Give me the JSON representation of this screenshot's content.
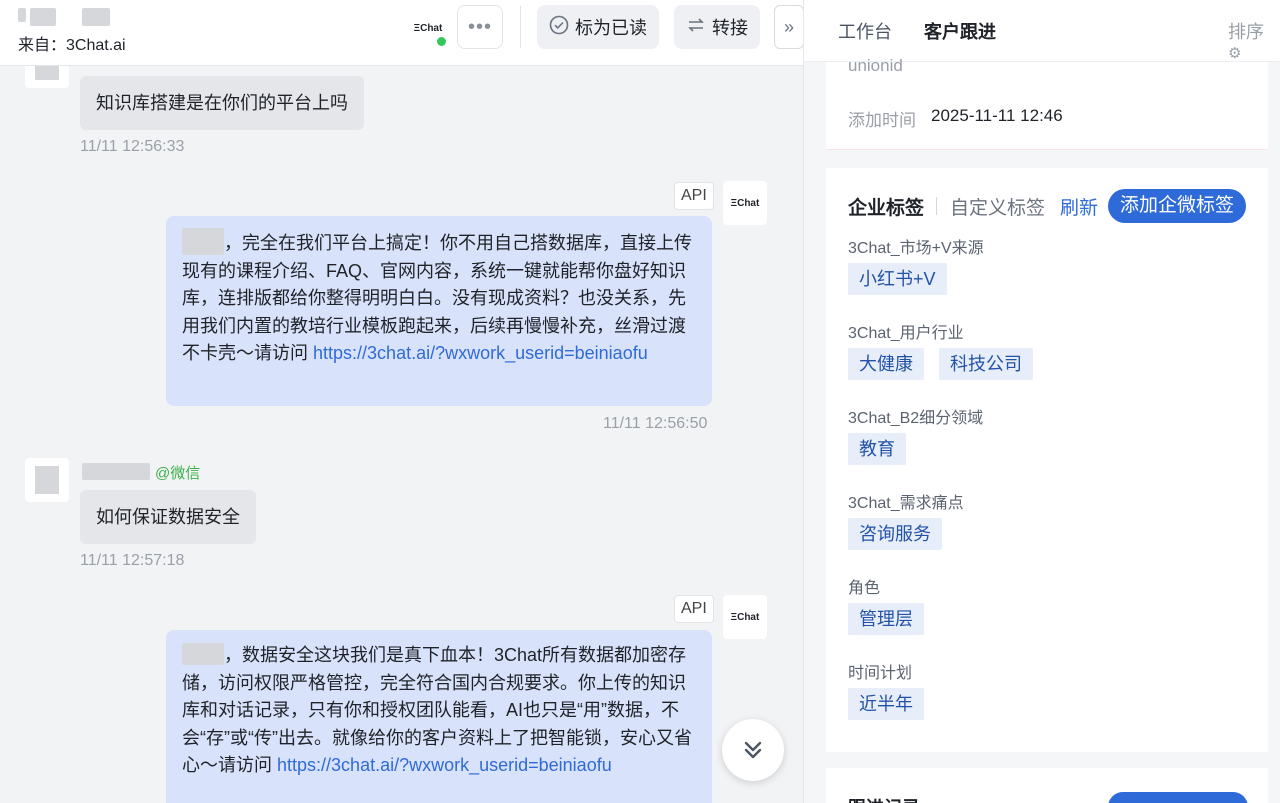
{
  "chat": {
    "source_prefix": "来自：",
    "source_value": "3Chat.ai",
    "brand_mark": "ΞChat",
    "more_label": "•••",
    "mark_read_label": "标为已读",
    "transfer_label": "转接",
    "expand_label": "»",
    "messages": [
      {
        "text": "知识库搭建是在你们的平台上吗",
        "time": "11/11 12:56:33"
      },
      {
        "tag": "API",
        "bot": "ΞChat",
        "text": "，完全在我们平台上搞定！你不用自己搭数据库，直接上传现有的课程介绍、FAQ、官网内容，系统一键就能帮你盘好知识库，连排版都给你整得明明白白。没有现成资料？也没关系，先用我们内置的教培行业模板跑起来，后续再慢慢补充，丝滑过渡不卡壳～请访问 ",
        "link": "https://3chat.ai/?wxwork_userid=beiniaofu",
        "time": "11/11 12:56:50"
      },
      {
        "sender_tag": "@微信",
        "text": "如何保证数据安全",
        "time": "11/11 12:57:18"
      },
      {
        "tag": "API",
        "bot": "ΞChat",
        "text": "，数据安全这块我们是真下血本！3Chat所有数据都加密存储，访问权限严格管控，完全符合国内合规要求。你上传的知识库和对话记录，只有你和授权团队能看，AI也只是“用”数据，不会“存”或“传”出去。就像给你的客户资料上了把智能锁，安心又省心～请访问 ",
        "link": "https://3chat.ai/?wxwork_userid=beiniaofu"
      }
    ],
    "scroll_down": "⌄⌄"
  },
  "panel": {
    "tabs": [
      "工作台",
      "客户跟进"
    ],
    "active_tab": 1,
    "sort_label": "排序",
    "partial_top": "unionid",
    "add_time_label": "添加时间",
    "add_time_value": "2025-11-11 12:46",
    "tag_tabs": [
      "企业标签",
      "自定义标签"
    ],
    "refresh_label": "刷新",
    "add_tag_label": "添加企微标签",
    "tag_groups": [
      {
        "title": "3Chat_市场+V来源",
        "tags": [
          "小红书+V"
        ]
      },
      {
        "title": "3Chat_用户行业",
        "tags": [
          "大健康",
          "科技公司"
        ]
      },
      {
        "title": "3Chat_B2细分领域",
        "tags": [
          "教育"
        ]
      },
      {
        "title": "3Chat_需求痛点",
        "tags": [
          "咨询服务"
        ]
      },
      {
        "title": "角色",
        "tags": [
          "管理层"
        ]
      },
      {
        "title": "时间计划",
        "tags": [
          "近半年"
        ]
      }
    ],
    "followup_title": "跟进记录"
  },
  "colors": {
    "accent": "#2f6bd8",
    "online": "#34c759",
    "wechat": "#3cb04a"
  }
}
